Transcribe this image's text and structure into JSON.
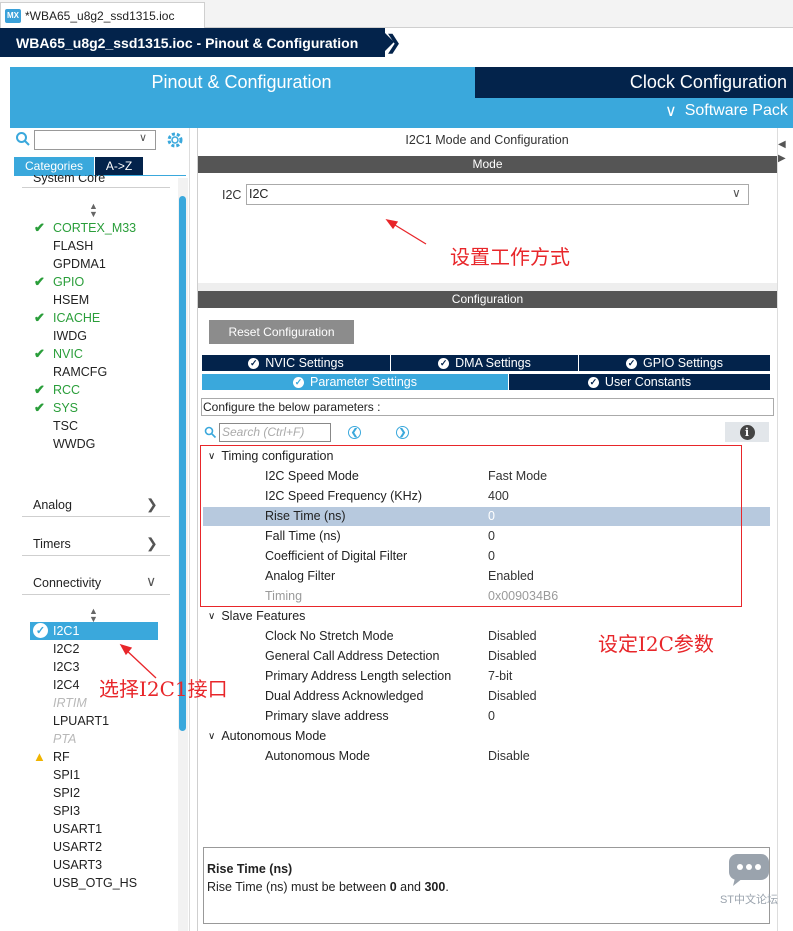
{
  "editor_tab": {
    "icon_label": "MX",
    "title": "*WBA65_u8g2_ssd1315.ioc"
  },
  "breadcrumb": {
    "text": "WBA65_u8g2_ssd1315.ioc - Pinout & Configuration"
  },
  "main_tabs": {
    "pinout": "Pinout & Configuration",
    "clock": "Clock Configuration",
    "software_packs": "Software Pack"
  },
  "left": {
    "categories_label": "Categories",
    "az_label": "A->Z",
    "system_core_header": "System Core",
    "system_core_items": [
      {
        "label": "CORTEX_M33",
        "state": "checked"
      },
      {
        "label": "FLASH",
        "state": "normal"
      },
      {
        "label": "GPDMA1",
        "state": "normal"
      },
      {
        "label": "GPIO",
        "state": "checked"
      },
      {
        "label": "HSEM",
        "state": "normal"
      },
      {
        "label": "ICACHE",
        "state": "checked"
      },
      {
        "label": "IWDG",
        "state": "normal"
      },
      {
        "label": "NVIC",
        "state": "checked"
      },
      {
        "label": "RAMCFG",
        "state": "normal"
      },
      {
        "label": "RCC",
        "state": "checked"
      },
      {
        "label": "SYS",
        "state": "checked"
      },
      {
        "label": "TSC",
        "state": "normal"
      },
      {
        "label": "WWDG",
        "state": "normal"
      }
    ],
    "sections": {
      "analog": "Analog",
      "timers": "Timers",
      "connectivity": "Connectivity"
    },
    "connectivity_items": [
      {
        "label": "I2C1",
        "state": "selected"
      },
      {
        "label": "I2C2",
        "state": "normal"
      },
      {
        "label": "I2C3",
        "state": "normal"
      },
      {
        "label": "I2C4",
        "state": "normal"
      },
      {
        "label": "IRTIM",
        "state": "disabled"
      },
      {
        "label": "LPUART1",
        "state": "normal"
      },
      {
        "label": "PTA",
        "state": "disabled"
      },
      {
        "label": "RF",
        "state": "warning"
      },
      {
        "label": "SPI1",
        "state": "normal"
      },
      {
        "label": "SPI2",
        "state": "normal"
      },
      {
        "label": "SPI3",
        "state": "normal"
      },
      {
        "label": "USART1",
        "state": "normal"
      },
      {
        "label": "USART2",
        "state": "normal"
      },
      {
        "label": "USART3",
        "state": "normal"
      },
      {
        "label": "USB_OTG_HS",
        "state": "normal"
      }
    ]
  },
  "right": {
    "title": "I2C1 Mode and Configuration",
    "mode_header": "Mode",
    "i2c_label": "I2C",
    "i2c_value": "I2C",
    "config_header": "Configuration",
    "reset_button": "Reset Configuration",
    "tabs_row1": [
      "NVIC Settings",
      "DMA Settings",
      "GPIO Settings"
    ],
    "tabs_row2": [
      "Parameter Settings",
      "User Constants"
    ],
    "config_hint": "Configure the below parameters :",
    "search_placeholder": "Search (Ctrl+F)",
    "groups": {
      "timing": "Timing configuration",
      "slave": "Slave Features",
      "autonomous": "Autonomous Mode"
    },
    "timing_params": [
      {
        "name": "I2C Speed Mode",
        "value": "Fast Mode"
      },
      {
        "name": "I2C Speed Frequency (KHz)",
        "value": "400"
      },
      {
        "name": "Rise Time (ns)",
        "value": "0"
      },
      {
        "name": "Fall Time (ns)",
        "value": "0"
      },
      {
        "name": "Coefficient of Digital Filter",
        "value": "0"
      },
      {
        "name": "Analog Filter",
        "value": "Enabled"
      },
      {
        "name": "Timing",
        "value": "0x009034B6"
      }
    ],
    "slave_params": [
      {
        "name": "Clock No Stretch Mode",
        "value": "Disabled"
      },
      {
        "name": "General Call Address Detection",
        "value": "Disabled"
      },
      {
        "name": "Primary Address Length selection",
        "value": "7-bit"
      },
      {
        "name": "Dual Address Acknowledged",
        "value": "Disabled"
      },
      {
        "name": "Primary slave address",
        "value": "0"
      }
    ],
    "autonomous_params": [
      {
        "name": "Autonomous Mode",
        "value": "Disable"
      }
    ],
    "description": {
      "title": "Rise Time (ns)",
      "text_prefix": "Rise Time (ns) must be between ",
      "min": "0",
      "and": " and ",
      "max": "300",
      "suffix": "."
    }
  },
  "annotations": {
    "set_mode": "设置工作方式",
    "set_params": "设定I2C参数",
    "select_iface": "选择I2C1接口",
    "annotation_color": "#e8262a"
  },
  "watermark": "ST中文论坛",
  "colors": {
    "navy": "#03234b",
    "accent": "#3aa8dc",
    "check": "#2a9e3a"
  }
}
